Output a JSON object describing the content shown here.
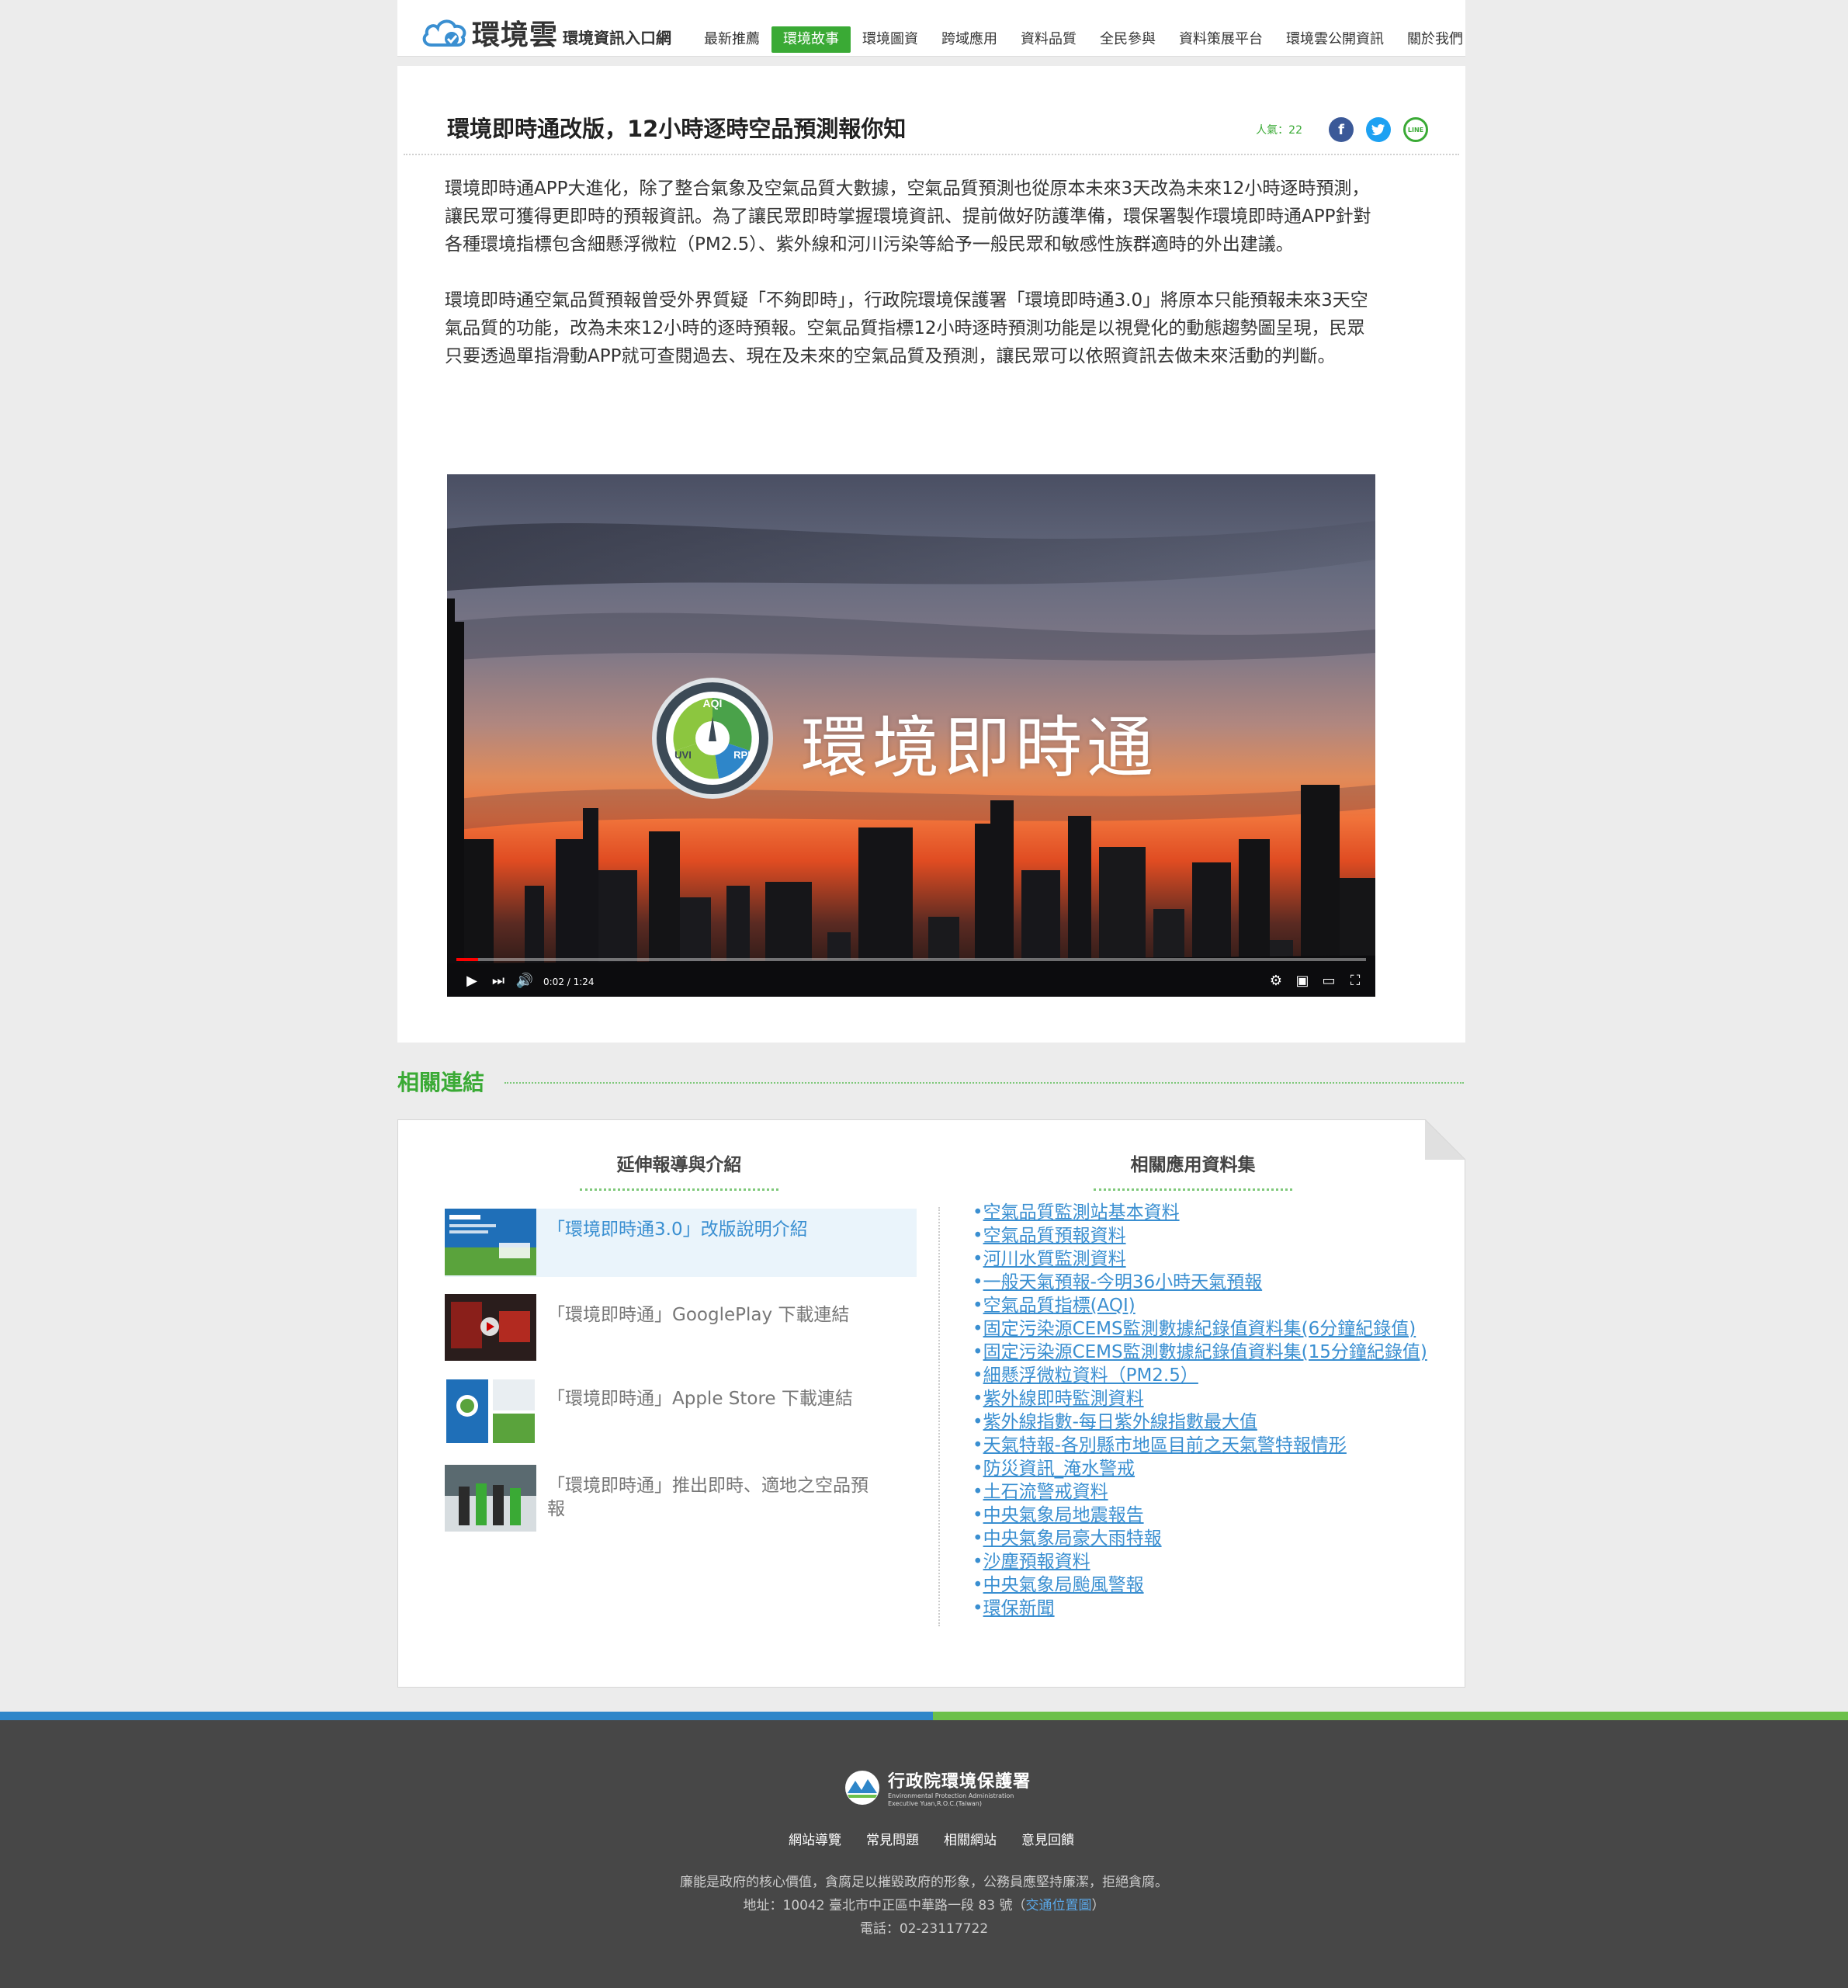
{
  "header": {
    "logo_title": "環境雲",
    "logo_subtitle": "環境資訊入口網",
    "nav": [
      {
        "label": "最新推薦",
        "active": false
      },
      {
        "label": "環境故事",
        "active": true
      },
      {
        "label": "環境圖資",
        "active": false
      },
      {
        "label": "跨域應用",
        "active": false
      },
      {
        "label": "資料品質",
        "active": false
      },
      {
        "label": "全民參與",
        "active": false
      },
      {
        "label": "資料策展平台",
        "active": false
      },
      {
        "label": "環境雲公開資訊",
        "active": false
      },
      {
        "label": "關於我們",
        "active": false
      }
    ]
  },
  "article": {
    "title": "環境即時通改版，12小時逐時空品預測報你知",
    "views": "人氣：22",
    "paragraphs": [
      "環境即時通APP大進化，除了整合氣象及空氣品質大數據，空氣品質預測也從原本未來3天改為未來12小時逐時預測，讓民眾可獲得更即時的預報資訊。為了讓民眾即時掌握環境資訊、提前做好防護準備，環保署製作環境即時通APP針對各種環境指標包含細懸浮微粒（PM2.5）、紫外線和河川污染等給予一般民眾和敏感性族群適時的外出建議。",
      "環境即時通空氣品質預報曾受外界質疑「不夠即時」，行政院環境保護署「環境即時通3.0」將原本只能預報未來3天空氣品質的功能，改為未來12小時的逐時預報。空氣品質指標12小時逐時預測功能是以視覺化的動態趨勢圖呈現，民眾只要透過單指滑動APP就可查閱過去、現在及未來的空氣品質及預測，讓民眾可以依照資訊去做未來活動的判斷。"
    ]
  },
  "video": {
    "overlay_title": "環境即時通",
    "logo_top": "AQI",
    "logo_left": "UVI",
    "logo_right": "RPI",
    "time": "0:02 / 1:24",
    "progress": 0.024
  },
  "related": {
    "heading": "相關連結",
    "ext_heading": "延伸報導與介紹",
    "data_heading": "相關應用資料集",
    "ext_items": [
      {
        "label": "「環境即時通3.0」改版說明介紹",
        "highlight": true
      },
      {
        "label": "「環境即時通」GooglePlay 下載連結",
        "highlight": false
      },
      {
        "label": "「環境即時通」Apple Store 下載連結",
        "highlight": false
      },
      {
        "label": "「環境即時通」推出即時、適地之空品預報",
        "highlight": false
      }
    ],
    "datasets": [
      "空氣品質監測站基本資料",
      "空氣品質預報資料",
      "河川水質監測資料",
      "一般天氣預報-今明36小時天氣預報",
      "空氣品質指標(AQI)",
      "固定污染源CEMS監測數據紀錄值資料集(6分鐘紀錄值)",
      "固定污染源CEMS監測數據紀錄值資料集(15分鐘紀錄值)",
      "細懸浮微粒資料（PM2.5）",
      "紫外線即時監測資料",
      "紫外線指數-每日紫外線指數最大值",
      "天氣特報-各別縣市地區目前之天氣警特報情形",
      "防災資訊_淹水警戒",
      "土石流警戒資料",
      "中央氣象局地震報告",
      "中央氣象局豪大雨特報",
      "沙塵預報資料",
      "中央氣象局颱風警報",
      "環保新聞"
    ]
  },
  "footer": {
    "org_name": "行政院環境保護署",
    "org_en_1": "Environmental Protection Administration",
    "org_en_2": "Executive Yuan,R.O.C.(Taiwan)",
    "links": [
      "網站導覽",
      "常見問題",
      "相關網站",
      "意見回饋"
    ],
    "motto": "廉能是政府的核心價值，貪腐足以摧毀政府的形象，公務員應堅持廉潔，拒絕貪腐。",
    "address_prefix": "地址：10042 臺北市中正區中華路一段 83 號（",
    "address_link": "交通位置圖",
    "address_suffix": "）",
    "phone": "電話：02-23117722"
  },
  "colors": {
    "brand_green": "#3aaa35",
    "link_blue": "#3a8fd1",
    "footer_bg": "#474747",
    "bar_blue": "#2e86c9",
    "bar_green": "#6cc04a"
  }
}
